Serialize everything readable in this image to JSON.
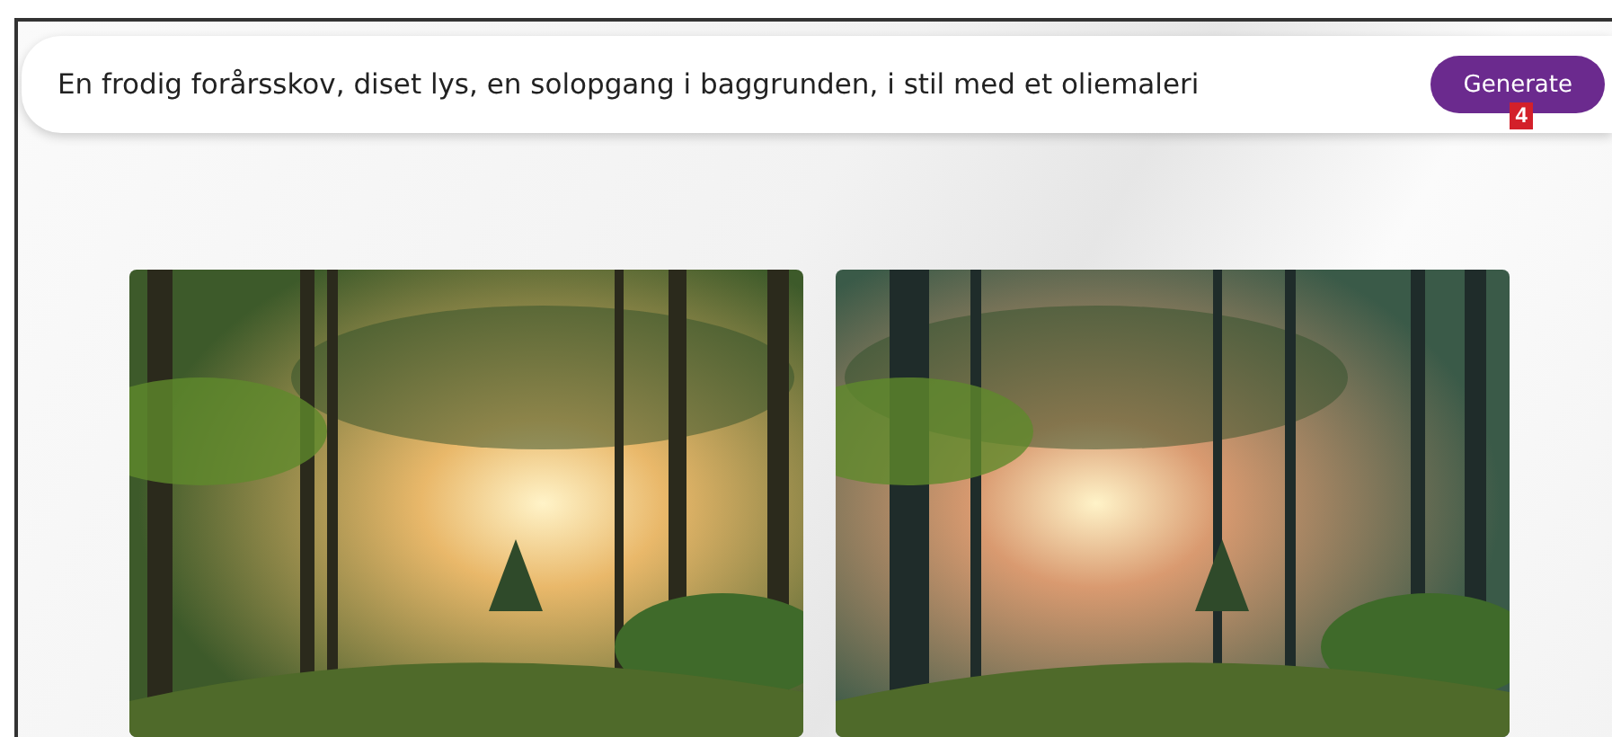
{
  "prompt": {
    "value": "En frodig forårsskov, diset lys, en solopgang i baggrunden, i stil med et oliemaleri"
  },
  "generate_button": {
    "label": "Generate",
    "callout": "4"
  }
}
